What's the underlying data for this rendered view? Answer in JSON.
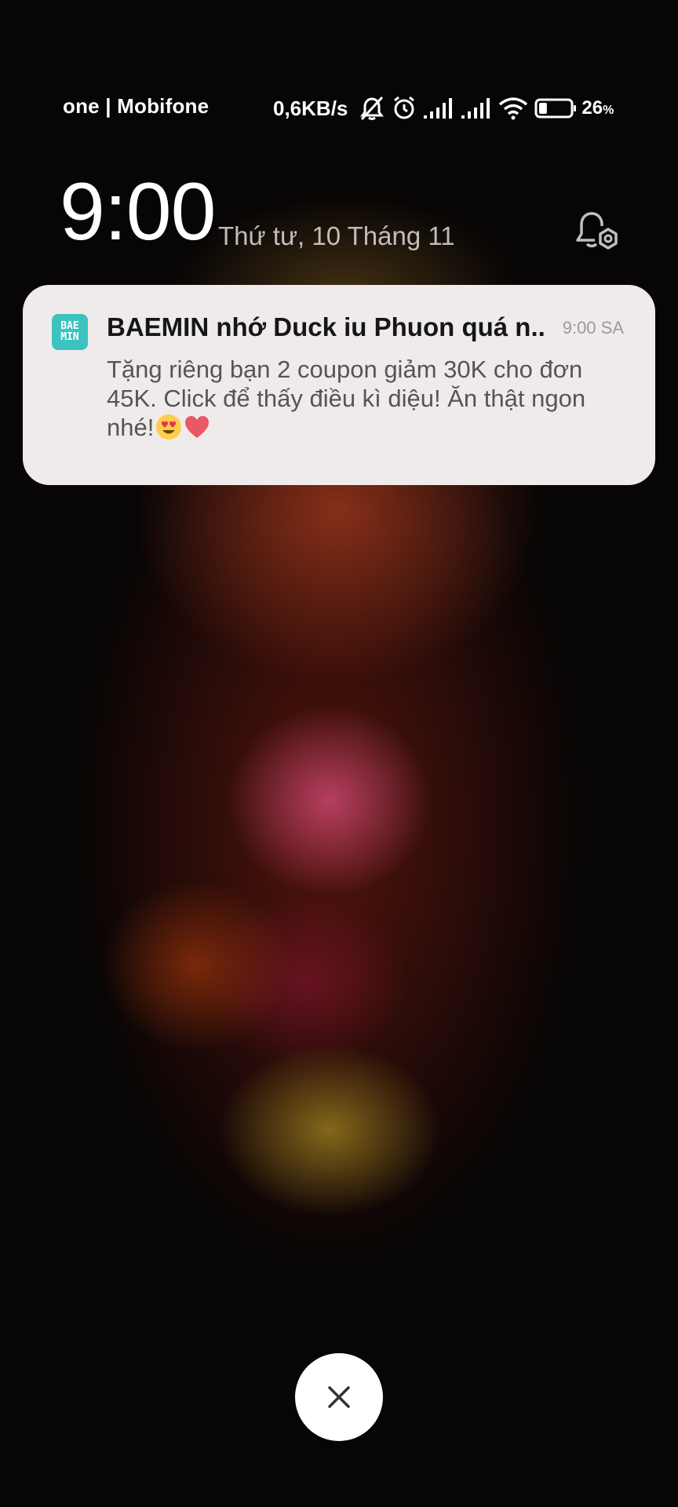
{
  "status_bar": {
    "carrier": "one | Mobifone",
    "net_speed": "0,6KB/s",
    "battery_percent": "26",
    "battery_unit": "%",
    "battery_level": 0.26,
    "icons": [
      "bell-muted-icon",
      "alarm-icon",
      "signal-1-icon",
      "signal-2-icon",
      "wifi-icon",
      "battery-icon"
    ]
  },
  "lockscreen": {
    "time": "9:00",
    "date": "Thứ tư, 10 Tháng 11",
    "settings_icon": "notification-settings-icon"
  },
  "notification": {
    "app_icon_text_line1": "BAE",
    "app_icon_text_line2": "MIN",
    "app_icon_color": "#3cc3c0",
    "title": "BAEMIN nhớ Duck iu Phuon quá n..",
    "time": "9:00 SA",
    "body": "Tặng riêng bạn 2 coupon giảm 30K cho đơn 45K. Click để thấy điều kì diệu! Ăn thật ngon nhé!",
    "emojis": [
      "heart-eyes-emoji",
      "red-heart-emoji"
    ]
  },
  "dismiss": {
    "icon": "close-icon"
  }
}
